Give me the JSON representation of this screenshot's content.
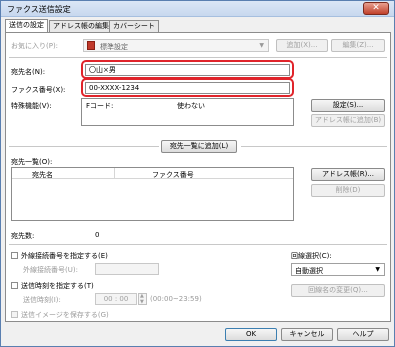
{
  "window": {
    "title": "ファクス送信設定",
    "close_glyph": "✕"
  },
  "tabs": [
    "送信の設定",
    "アドレス帳の編集",
    "カバーシート"
  ],
  "favorites": {
    "label": "お気に入り(P):",
    "value": "標準設定",
    "add_button": "追加(X)...",
    "edit_button": "編集(Z)..."
  },
  "recipient_name": {
    "label": "宛先名(N):",
    "value": "〇山×男"
  },
  "fax_number": {
    "label": "ファクス番号(X):",
    "value": "00-XXXX-1234"
  },
  "features": {
    "label": "特殊機能(V):",
    "col1": "Fコード:",
    "col2": "使わない",
    "settings_button": "設定(S)...",
    "add_to_addressbook_button": "アドレス帳に追加(B)"
  },
  "add_to_list_button": "宛先一覧に追加(L)",
  "recipient_list": {
    "label": "宛先一覧(O):",
    "columns": [
      "宛先名",
      "ファクス番号"
    ],
    "addressbook_button": "アドレス帳(R)...",
    "delete_button": "削除(D)"
  },
  "recipient_count": {
    "label": "宛先数:",
    "value": "0"
  },
  "outside_line": {
    "label": "外線接続番号を指定する(E)",
    "sub_label": "外線接続番号(U):"
  },
  "line_select": {
    "label": "回線選択(C):",
    "value": "自動選択",
    "change_button": "回線名の変更(Q)..."
  },
  "send_time": {
    "label": "送信時刻を指定する(T)",
    "sub_label": "送信時刻(I):",
    "value": "00 : 00",
    "range": "(00:00~23:59)"
  },
  "save_image": {
    "label": "送信イメージを保存する(G)"
  },
  "footer": {
    "ok": "OK",
    "cancel": "キャンセル",
    "help": "ヘルプ"
  }
}
